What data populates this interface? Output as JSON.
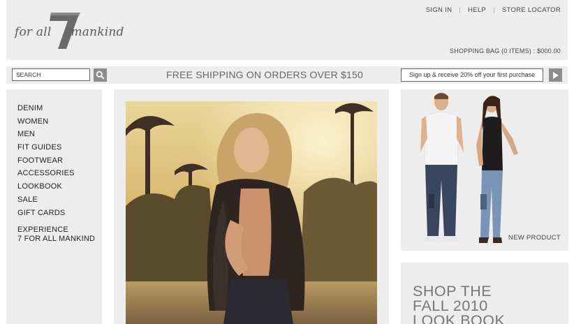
{
  "header": {
    "logo_text_1": "for all",
    "logo_text_2": "mankind",
    "links": [
      "SIGN IN",
      "HELP",
      "STORE LOCATOR"
    ],
    "shopping_bag": "SHOPPING BAG (0 ITEMS) : $000.00"
  },
  "bar": {
    "search_value": "SEARCH",
    "promo": "FREE SHIPPING ON ORDERS OVER $150",
    "signup": "Sign up & receive 20% off your first purchase"
  },
  "sidebar": {
    "items": [
      "DENIM",
      "WOMEN",
      "MEN",
      "FIT GUIDES",
      "FOOTWEAR",
      "ACCESSORIES",
      "LOOKBOOK",
      "SALE",
      "GIFT CARDS"
    ],
    "experience_line1": "EXPERIENCE",
    "experience_line2": "7 FOR ALL MANKIND"
  },
  "product": {
    "label": "NEW PRODUCT"
  },
  "lookbook": {
    "line1": "SHOP THE",
    "line2": "FALL 2010",
    "line3": "LOOK BOOK"
  },
  "colors": {
    "panel": "#ededee",
    "button": "#8c8c8c",
    "text": "#333333"
  }
}
